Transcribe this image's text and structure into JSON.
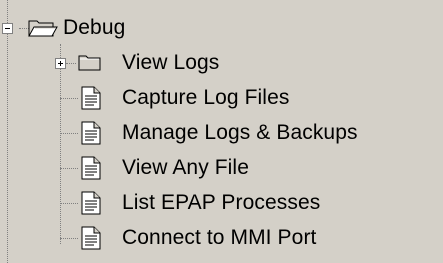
{
  "tree": {
    "root": {
      "label": "Debug",
      "expander": "minus",
      "icon": "open-folder-icon"
    },
    "children": [
      {
        "label": "View Logs",
        "expander": "plus",
        "icon": "folder-icon"
      },
      {
        "label": "Capture Log Files",
        "icon": "document-icon"
      },
      {
        "label": "Manage Logs & Backups",
        "icon": "document-icon"
      },
      {
        "label": "View Any File",
        "icon": "document-icon"
      },
      {
        "label": "List EPAP Processes",
        "icon": "document-icon"
      },
      {
        "label": "Connect to MMI Port",
        "icon": "document-icon"
      }
    ]
  },
  "colors": {
    "background": "#d4d0c8",
    "connector": "#808080",
    "folder_fill": "#d4d0c8",
    "text": "#000000"
  }
}
